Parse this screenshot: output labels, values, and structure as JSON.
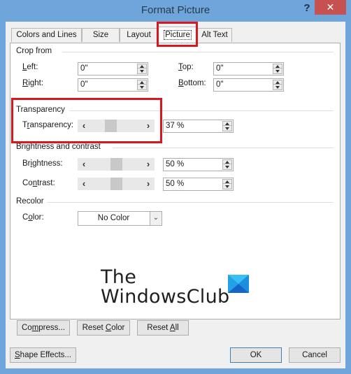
{
  "window": {
    "title": "Format Picture",
    "help_label": "?",
    "close_label": "✕"
  },
  "tabs": [
    {
      "label": "Colors and Lines",
      "active": false
    },
    {
      "label": "Size",
      "active": false
    },
    {
      "label": "Layout",
      "active": false
    },
    {
      "label": "Picture",
      "active": true
    },
    {
      "label": "Alt Text",
      "active": false
    }
  ],
  "crop": {
    "group_label": "Crop from",
    "left": {
      "label_pre": "",
      "label_u": "L",
      "label_post": "eft:",
      "value": "0\""
    },
    "right": {
      "label_pre": "",
      "label_u": "R",
      "label_post": "ight:",
      "value": "0\""
    },
    "top": {
      "label_pre": "",
      "label_u": "T",
      "label_post": "op:",
      "value": "0\""
    },
    "bottom": {
      "label_pre": "",
      "label_u": "B",
      "label_post": "ottom:",
      "value": "0\""
    }
  },
  "transparency": {
    "group_label": "Transparency",
    "label_pre": "T",
    "label_u": "r",
    "label_post": "ansparency:",
    "value": "37 %",
    "percent": 37
  },
  "brightness_contrast": {
    "group_label": "Brightness and contrast",
    "brightness": {
      "label_pre": "Br",
      "label_u": "i",
      "label_post": "ghtness:",
      "value": "50 %",
      "percent": 50
    },
    "contrast": {
      "label_pre": "Co",
      "label_u": "n",
      "label_post": "trast:",
      "value": "50 %",
      "percent": 50
    }
  },
  "recolor": {
    "group_label": "Recolor",
    "color": {
      "label_pre": "C",
      "label_u": "o",
      "label_post": "lor:",
      "value": "No Color"
    }
  },
  "logo": {
    "line1": "The",
    "line2": "WindowsClub"
  },
  "panel_buttons": {
    "compress": {
      "pre": "Co",
      "u": "m",
      "post": "press..."
    },
    "reset_color": {
      "pre": "Reset ",
      "u": "C",
      "post": "olor"
    },
    "reset_all": {
      "pre": "Reset ",
      "u": "A",
      "post": "ll"
    }
  },
  "footer": {
    "shape_effects": {
      "pre": "",
      "u": "S",
      "post": "hape Effects..."
    },
    "ok": "OK",
    "cancel": "Cancel"
  },
  "colors": {
    "title_bar": "#6ea6dc",
    "close_button": "#c75050",
    "highlight": "#d7191f"
  }
}
